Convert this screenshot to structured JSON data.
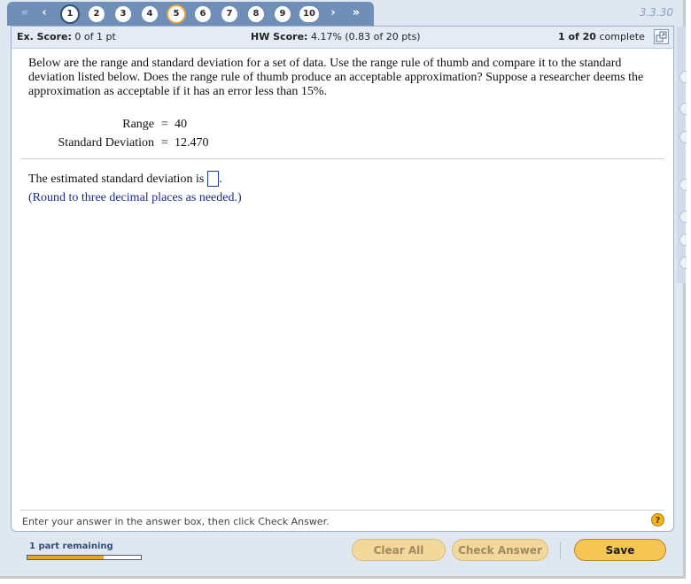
{
  "nav": {
    "prev_all": "«",
    "prev": "‹",
    "next": "›",
    "next_all": "»",
    "questions": [
      "1",
      "2",
      "3",
      "4",
      "5",
      "6",
      "7",
      "8",
      "9",
      "10"
    ],
    "version": "3.3.30"
  },
  "score": {
    "ex_label": "Ex. Score:",
    "ex_value": "0 of 1 pt",
    "hw_label": "HW Score:",
    "hw_value": "4.17% (0.83 of 20 pts)",
    "complete_count": "1 of 20",
    "complete_label": "complete"
  },
  "question": {
    "text": "Below are the range and standard deviation for a set of data. Use the range rule of thumb and compare it to the standard deviation listed below. Does the range rule of thumb produce an acceptable approximation? Suppose a researcher deems the approximation as acceptable if it has an error less than 15%.",
    "given": [
      {
        "label": "Range",
        "eq": "=",
        "value": "40"
      },
      {
        "label": "Standard Deviation",
        "eq": "=",
        "value": "12.470"
      }
    ],
    "answer_prefix": "The estimated standard deviation is",
    "answer_suffix": ".",
    "hint": "(Round to three decimal places as needed.)"
  },
  "footer": {
    "instruction": "Enter your answer in the answer box, then click Check Answer.",
    "help": "?",
    "remaining": "1 part remaining",
    "progress_fraction": 0.67,
    "clear_all": "Clear All",
    "check_answer": "Check Answer",
    "save": "Save"
  },
  "colors": {
    "nav_bg": "#6f8fb9",
    "accent_orange": "#f6c654",
    "hint_blue": "#1a2a8a"
  }
}
